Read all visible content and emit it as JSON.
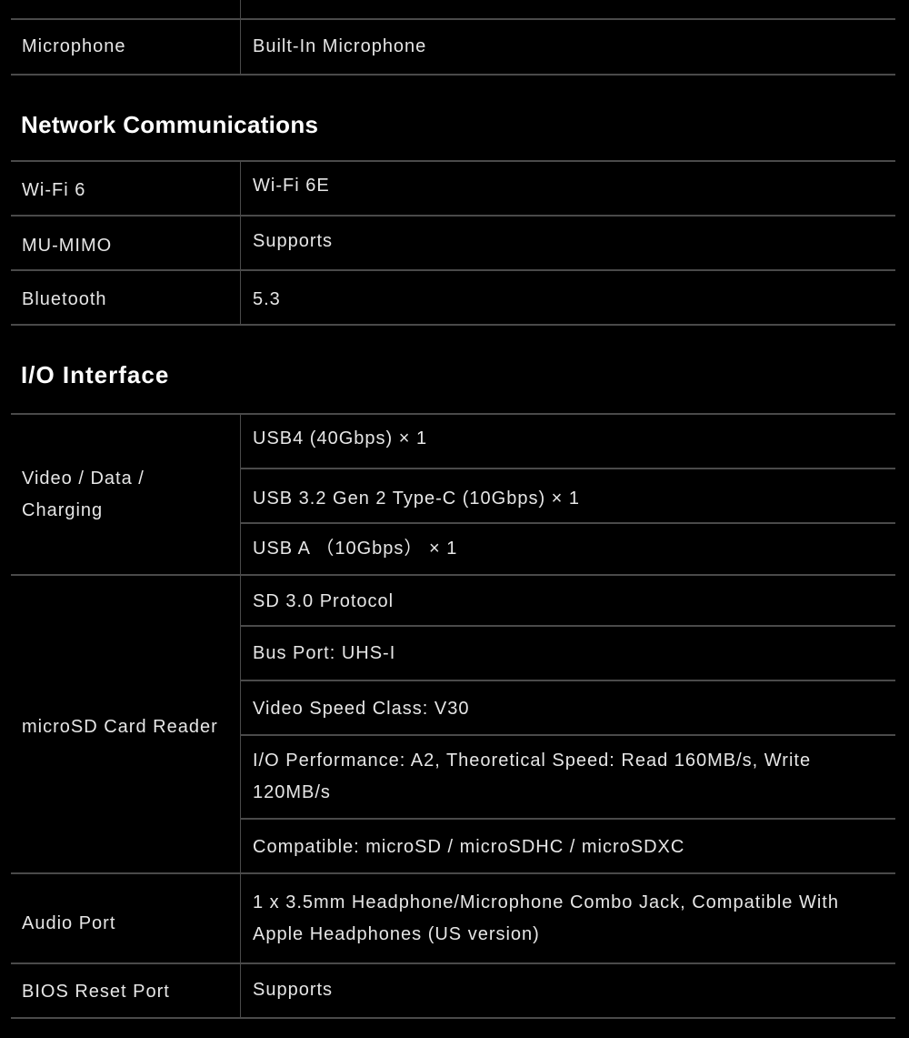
{
  "top_rows": [
    {
      "label": "Microphone",
      "value": "Built-In Microphone"
    }
  ],
  "network": {
    "title": "Network Communications",
    "rows": [
      {
        "label": "Wi-Fi 6",
        "value": "Wi-Fi 6E"
      },
      {
        "label": "MU-MIMO",
        "value": "Supports"
      },
      {
        "label": "Bluetooth",
        "value": "5.3"
      }
    ]
  },
  "io": {
    "title": "I/O Interface",
    "video": {
      "label": "Video / Data / Charging",
      "values": [
        "USB4 (40Gbps) × 1",
        "USB 3.2 Gen 2 Type-C (10Gbps) × 1",
        "USB A （10Gbps） × 1"
      ]
    },
    "sd": {
      "label": "microSD Card Reader",
      "values": [
        "SD 3.0 Protocol",
        "Bus Port: UHS-I",
        "Video Speed Class: V30",
        "I/O Performance: A2, Theoretical Speed: Read 160MB/s, Write 120MB/s",
        "Compatible: microSD / microSDHC / microSDXC"
      ]
    },
    "audio": {
      "label": "Audio Port",
      "value": "1 x 3.5mm Headphone/Microphone Combo Jack, Compatible With Apple Headphones (US version)"
    },
    "bios": {
      "label": "BIOS Reset Port",
      "value": "Supports"
    }
  }
}
